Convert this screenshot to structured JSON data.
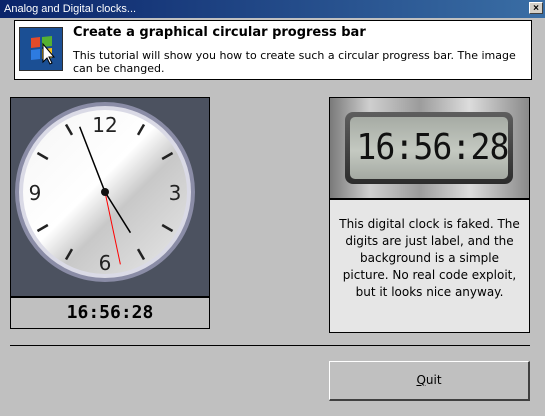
{
  "window": {
    "title": "Analog and Digital clocks...",
    "close_label": "×"
  },
  "header": {
    "heading": "Create a graphical circular progress bar",
    "description": "This tutorial will show you how to create such a circular progress bar. The image can be changed.",
    "icon": "windows-flag-cursor-icon"
  },
  "analog": {
    "numerals": [
      "12",
      "3",
      "6",
      "9"
    ],
    "time_readout": "16:56:28",
    "time": {
      "h": 16,
      "m": 56,
      "s": 28
    },
    "colors": {
      "hands": "#000000",
      "second_hand": "#ff0000",
      "background": "#4c5260"
    }
  },
  "digital": {
    "lcd_text": "16:56:28",
    "info_text": "This digital clock is faked. The digits are just label, and the background is a simple picture. No real code exploit, but it looks nice anyway."
  },
  "buttons": {
    "quit_first": "Q",
    "quit_rest": "uit"
  }
}
